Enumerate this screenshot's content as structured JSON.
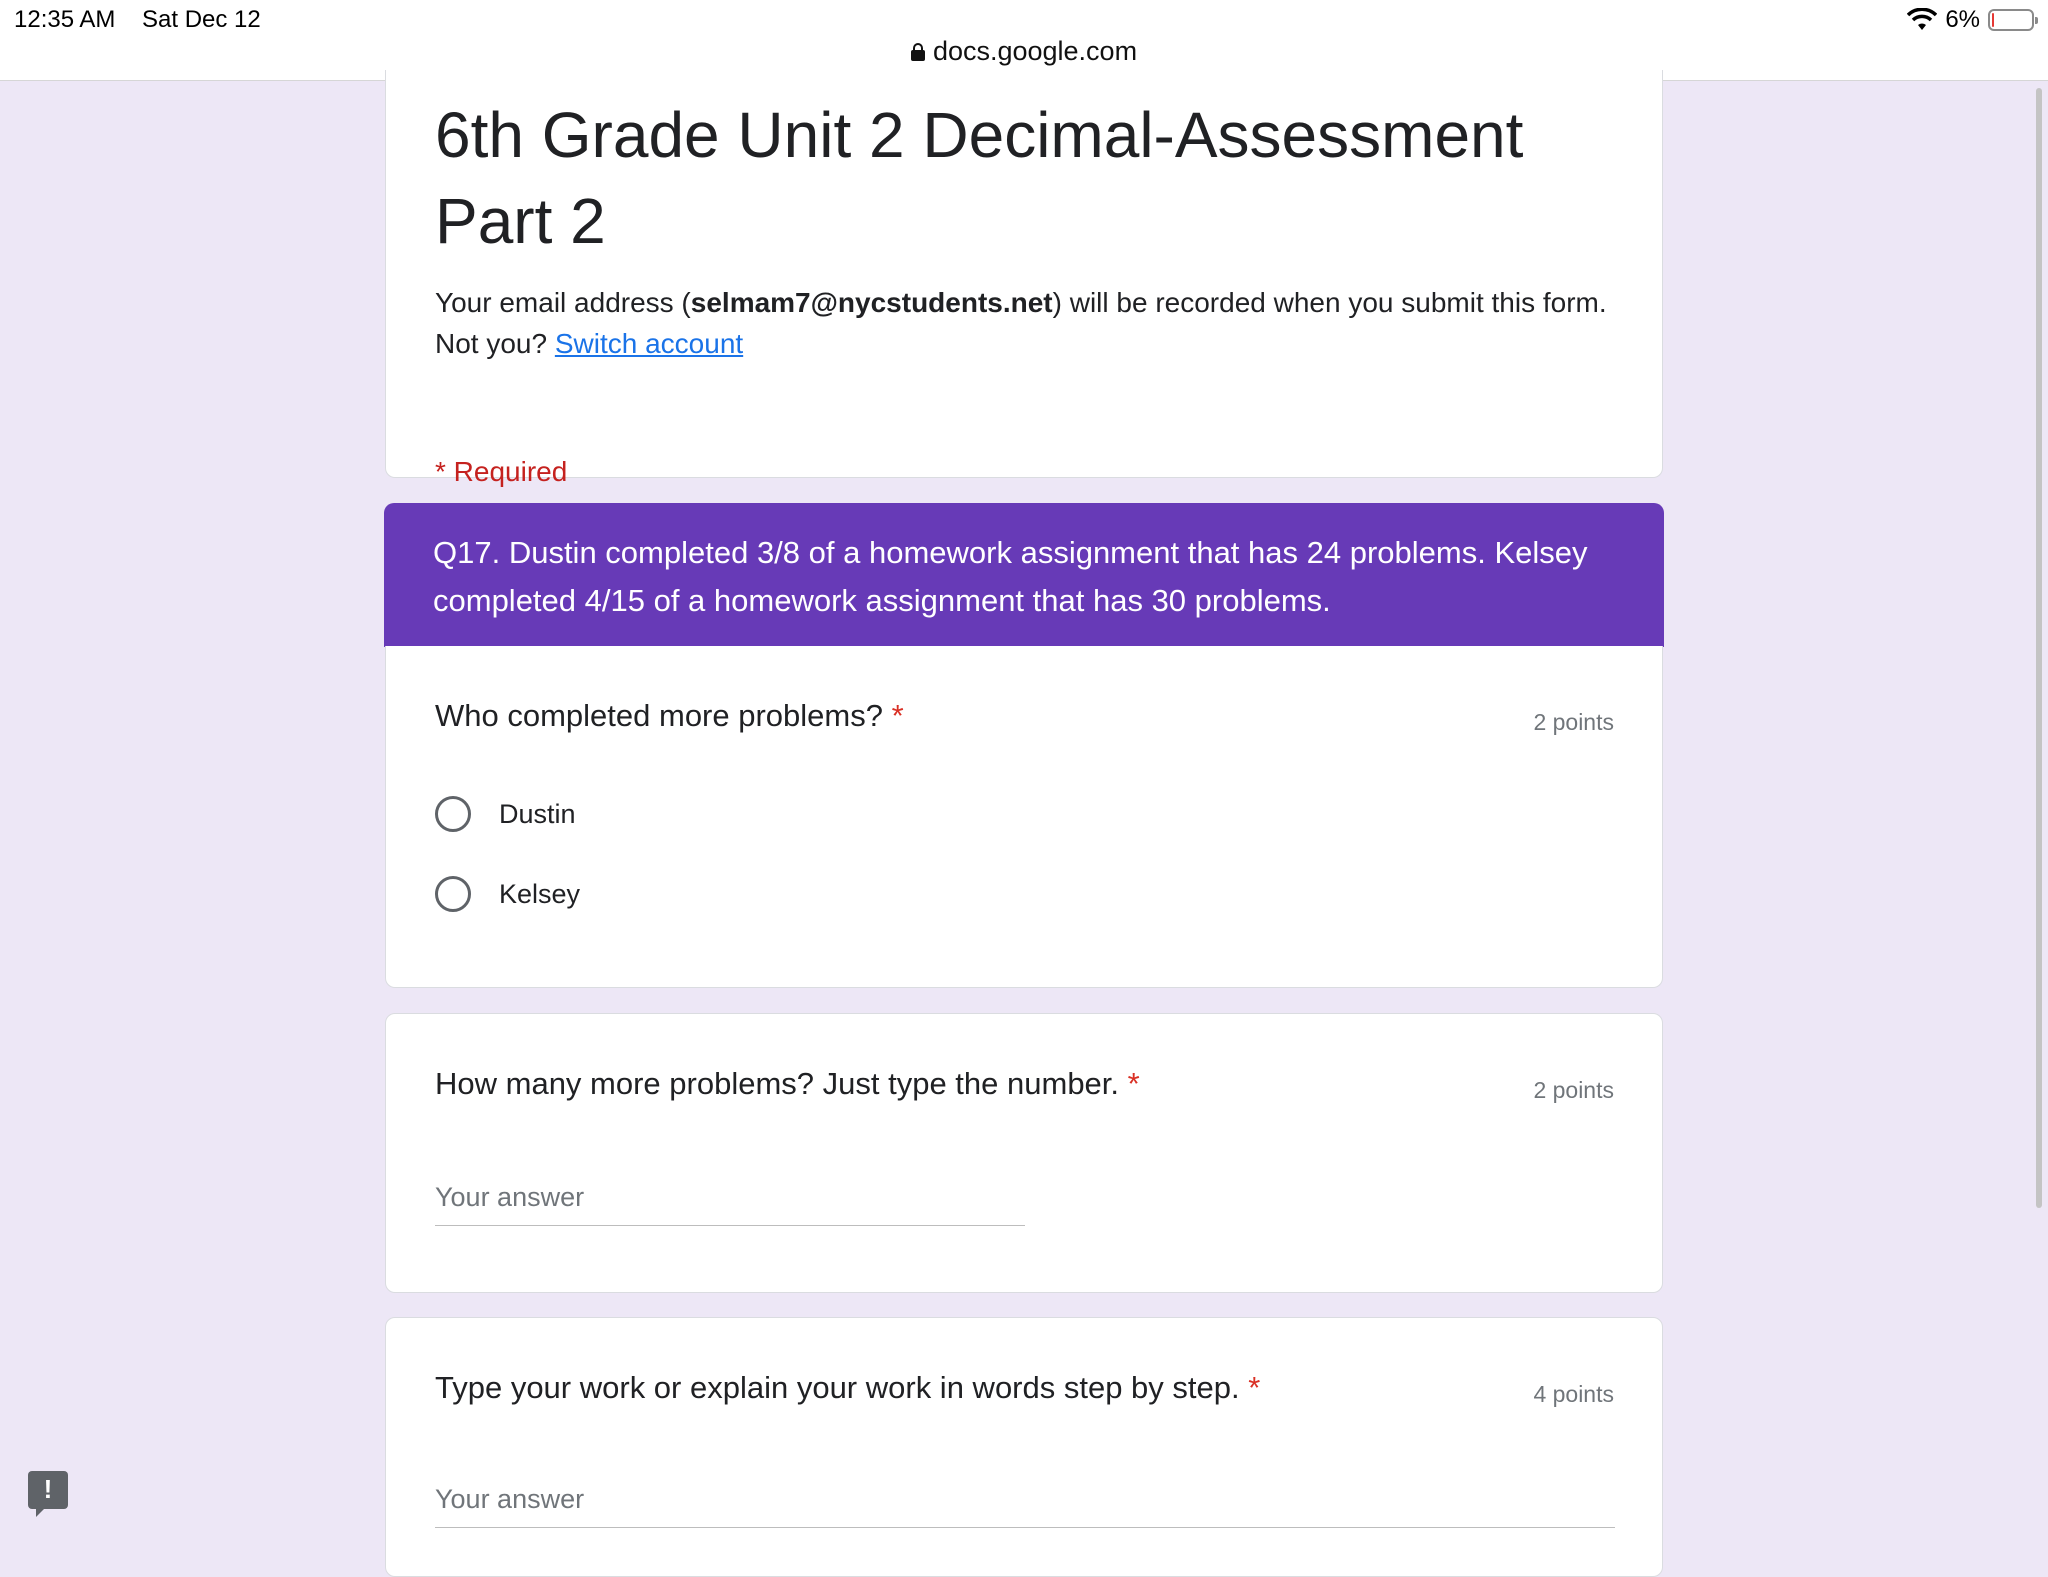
{
  "status_bar": {
    "time": "12:35 AM",
    "date": "Sat Dec 12",
    "battery": "6%",
    "battery_level": 0.06
  },
  "browser": {
    "url": "docs.google.com"
  },
  "form": {
    "title": "6th Grade Unit 2 Decimal-Assessment Part 2",
    "email_prefix": "Your email address (",
    "email": "selmam7@nycstudents.net",
    "email_suffix": ") will be recorded when you submit this form. Not you? ",
    "switch_account": "Switch account",
    "required_note": "* Required"
  },
  "section": {
    "description": "Q17. Dustin completed 3/8 of a homework assignment that has 24 problems. Kelsey completed 4/15 of a homework assignment that has 30 problems."
  },
  "questions": [
    {
      "title": "Who completed more problems?",
      "required_mark": "*",
      "points": "2 points",
      "options": [
        "Dustin",
        "Kelsey"
      ]
    },
    {
      "title": "How many more problems? Just type the number.",
      "required_mark": "*",
      "points": "2 points",
      "placeholder": "Your answer"
    },
    {
      "title": "Type your work or explain your work in words step by step.",
      "required_mark": "*",
      "points": "4 points",
      "placeholder": "Your answer"
    }
  ],
  "feedback_button": {
    "label": "!"
  }
}
